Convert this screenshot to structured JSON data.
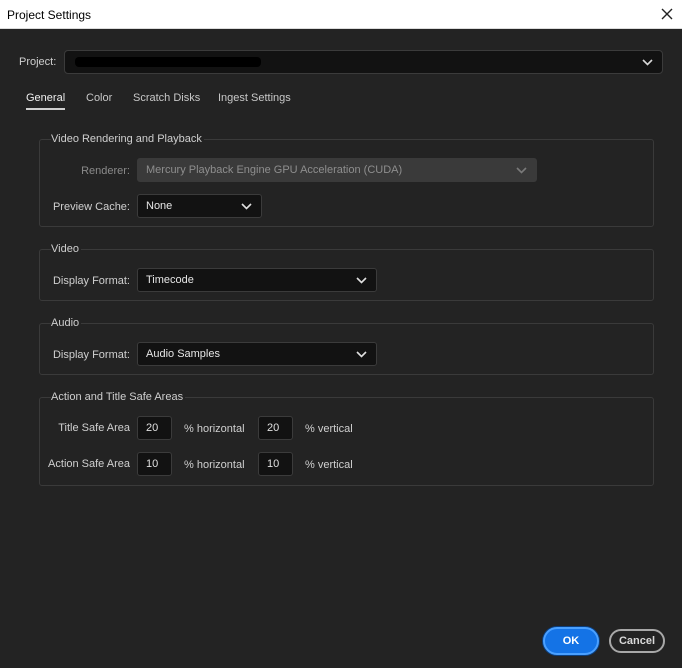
{
  "window": {
    "title": "Project Settings",
    "close_icon": "close-icon"
  },
  "project": {
    "label": "Project:",
    "value_redacted": true
  },
  "tabs": [
    {
      "label": "General",
      "active": true
    },
    {
      "label": "Color",
      "active": false
    },
    {
      "label": "Scratch Disks",
      "active": false
    },
    {
      "label": "Ingest Settings",
      "active": false
    }
  ],
  "video_rendering": {
    "title": "Video Rendering and Playback",
    "renderer_label": "Renderer:",
    "renderer_value": "Mercury Playback Engine GPU Acceleration (CUDA)",
    "preview_cache_label": "Preview Cache:",
    "preview_cache_value": "None"
  },
  "video": {
    "title": "Video",
    "display_format_label": "Display Format:",
    "display_format_value": "Timecode"
  },
  "audio": {
    "title": "Audio",
    "display_format_label": "Display Format:",
    "display_format_value": "Audio Samples"
  },
  "safe_areas": {
    "title": "Action and Title Safe Areas",
    "title_safe_label": "Title Safe Area",
    "title_safe_horizontal": "20",
    "title_safe_vertical": "20",
    "action_safe_label": "Action Safe Area",
    "action_safe_horizontal": "10",
    "action_safe_vertical": "10",
    "horizontal_suffix": "% horizontal",
    "vertical_suffix": "% vertical"
  },
  "buttons": {
    "ok": "OK",
    "cancel": "Cancel"
  },
  "colors": {
    "background": "#232323",
    "accent": "#1473e6",
    "field": "#121212"
  }
}
